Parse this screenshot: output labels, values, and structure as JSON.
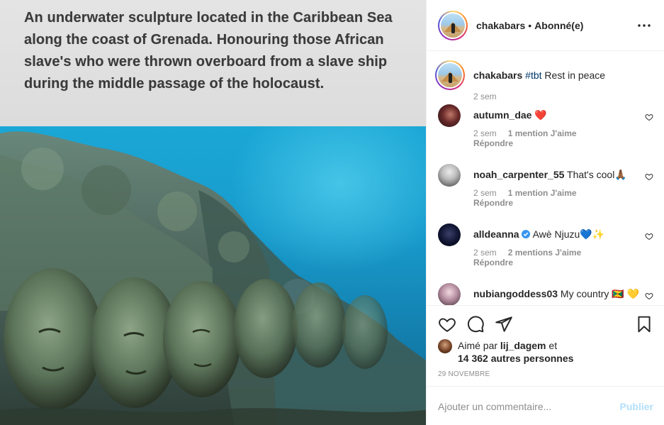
{
  "image": {
    "caption": "An underwater sculpture located in the Caribbean Sea along the coast of Grenada. Honouring those African slave's who were thrown overboard from a slave ship during the middle passage of the holocaust."
  },
  "header": {
    "username": "chakabars",
    "separator": "•",
    "follow_status": "Abonné(e)",
    "more_icon": "more-horizontal-icon"
  },
  "post_caption": {
    "username": "chakabars",
    "hashtag": "#tbt",
    "text": " Rest in peace",
    "time": "2 sem"
  },
  "comments": [
    {
      "username": "autumn_dae",
      "text": " ❤️",
      "time": "2 sem",
      "likes": "1 mention J'aime",
      "reply": "Répondre"
    },
    {
      "username": "noah_carpenter_55",
      "text": " That's cool🙏🏾",
      "time": "2 sem",
      "likes": "1 mention J'aime",
      "reply": "Répondre"
    },
    {
      "username": "alldeanna",
      "text": " Awè Njuzu💙✨",
      "time": "2 sem",
      "likes": "2 mentions J'aime",
      "reply": "Répondre"
    },
    {
      "username": "nubiangoddess03",
      "text": " My country 🇬🇩 💛",
      "time": "",
      "likes": "",
      "reply": ""
    }
  ],
  "likes": {
    "prefix": "Aimé par ",
    "user": "lij_dagem",
    "suffix": " et",
    "others": "14 362 autres personnes"
  },
  "date": "29 NOVEMBRE",
  "add_comment": {
    "placeholder": "Ajouter un commentaire...",
    "publish": "Publier"
  },
  "colors": {
    "link": "#00376b",
    "muted": "#8e8e8e",
    "publish_disabled": "#b2dffc"
  }
}
